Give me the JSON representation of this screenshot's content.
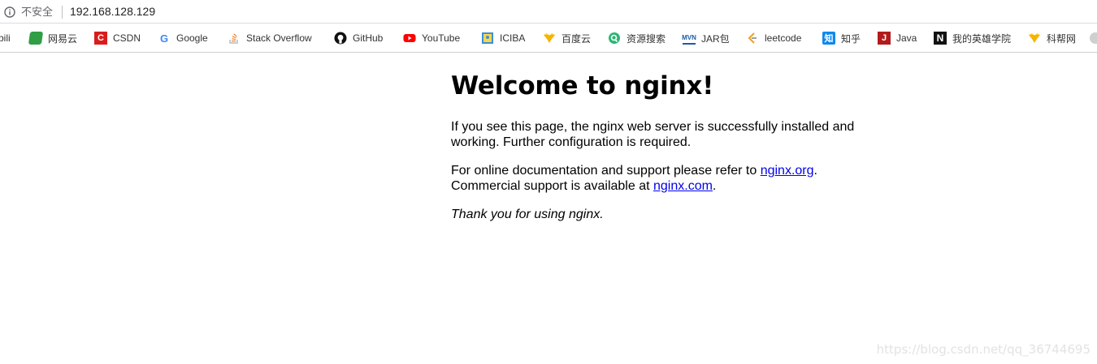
{
  "browser": {
    "security_label": "不安全",
    "url": "192.168.128.129"
  },
  "bookmarks": [
    {
      "label": "bili",
      "icon": "bilibili-icon"
    },
    {
      "label": "网易云",
      "icon": "netease-icon",
      "color": "#2f9e44"
    },
    {
      "label": "CSDN",
      "icon": "csdn-icon",
      "color": "#d71d1d"
    },
    {
      "label": "Google",
      "icon": "google-icon",
      "color": "#4285f4"
    },
    {
      "label": "Stack Overflow",
      "icon": "stackoverflow-icon",
      "color": "#f48024"
    },
    {
      "label": "GitHub",
      "icon": "github-icon",
      "color": "#111111"
    },
    {
      "label": "YouTube",
      "icon": "youtube-icon",
      "color": "#ff0000"
    },
    {
      "label": "ICIBA",
      "icon": "iciba-icon",
      "color": "#3b8fd9"
    },
    {
      "label": "百度云",
      "icon": "baiduyun-icon",
      "color": "#f5b400"
    },
    {
      "label": "资源搜索",
      "icon": "search-resource-icon",
      "color": "#2bb673"
    },
    {
      "label": "JAR包",
      "icon": "maven-icon",
      "color": "#1e5aa8"
    },
    {
      "label": "leetcode",
      "icon": "leetcode-icon",
      "color": "#f0a020"
    },
    {
      "label": "知乎",
      "icon": "zhihu-icon",
      "color": "#0f88eb"
    },
    {
      "label": "Java",
      "icon": "java-icon",
      "color": "#b31b1b"
    },
    {
      "label": "我的英雄学院",
      "icon": "notion-icon",
      "color": "#111111"
    },
    {
      "label": "科帮网",
      "icon": "kebang-icon",
      "color": "#f5b400"
    }
  ],
  "page": {
    "title": "Welcome to nginx!",
    "p1": "If you see this page, the nginx web server is successfully installed and working. Further configuration is required.",
    "p2_prefix": "For online documentation and support please refer to ",
    "link1": "nginx.org",
    "p2_mid": ".",
    "p2_line2": "Commercial support is available at ",
    "link2": "nginx.com",
    "p2_end": ".",
    "p3": "Thank you for using nginx."
  },
  "watermark": "https://blog.csdn.net/qq_36744695"
}
